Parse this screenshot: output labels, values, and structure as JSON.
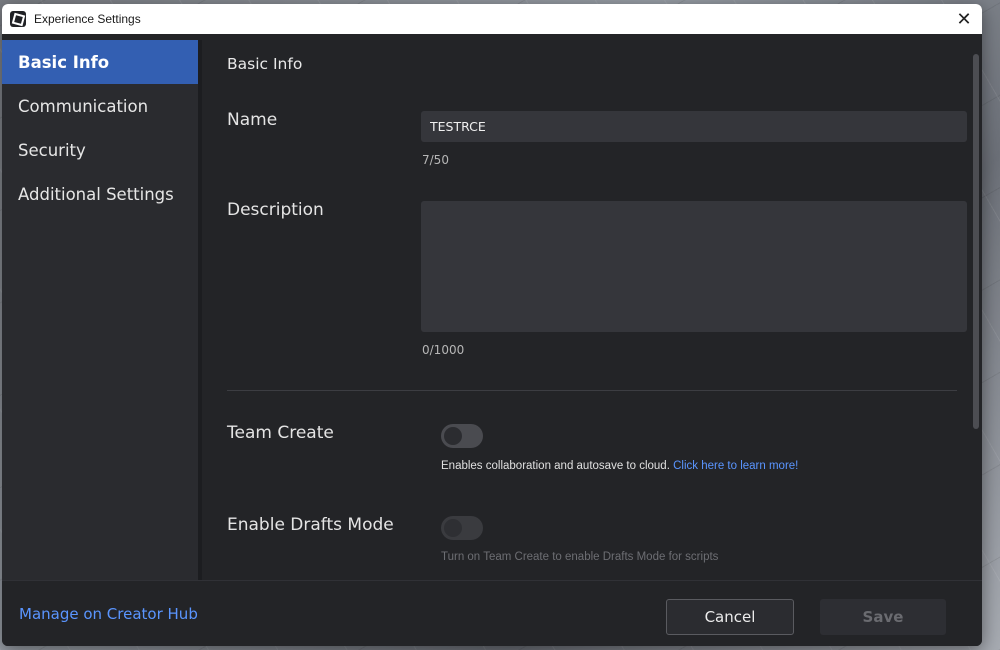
{
  "window": {
    "title": "Experience Settings",
    "close_glyph": "✕"
  },
  "sidebar": {
    "items": [
      {
        "label": "Basic Info",
        "active": true
      },
      {
        "label": "Communication",
        "active": false
      },
      {
        "label": "Security",
        "active": false
      },
      {
        "label": "Additional Settings",
        "active": false
      }
    ]
  },
  "main": {
    "section_title": "Basic Info",
    "name": {
      "label": "Name",
      "value": "TESTRCE",
      "counter": "7/50"
    },
    "description": {
      "label": "Description",
      "value": "",
      "counter": "0/1000"
    },
    "team_create": {
      "label": "Team Create",
      "enabled": false,
      "helper": "Enables collaboration and autosave to cloud.",
      "link": "Click here to learn more!"
    },
    "drafts_mode": {
      "label": "Enable Drafts Mode",
      "enabled": false,
      "disabled": true,
      "helper": "Turn on Team Create to enable Drafts Mode for scripts"
    }
  },
  "footer": {
    "manage_link": "Manage on Creator Hub",
    "cancel_label": "Cancel",
    "save_label": "Save"
  },
  "colors": {
    "accent": "#335fb2",
    "link": "#5a95ff",
    "background": "#232427",
    "sidebar": "#2a2b2f"
  }
}
